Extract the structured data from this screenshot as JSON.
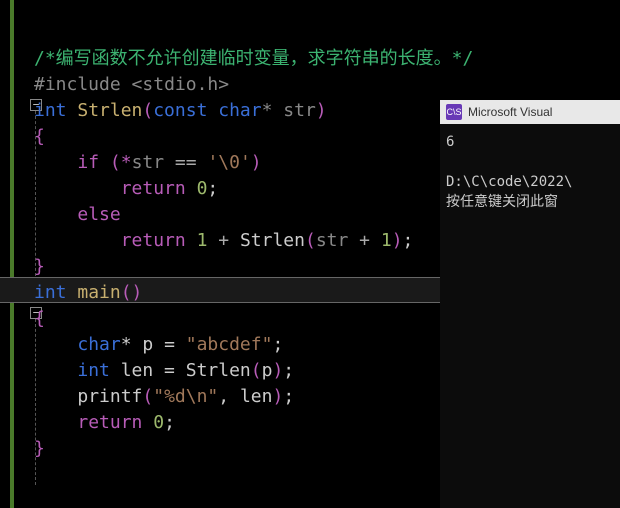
{
  "code": {
    "comment": "/*编写函数不允许创建临时变量，求字符串的长度。*/",
    "include_directive": "#include ",
    "include_open": "<",
    "include_header": "stdio.h",
    "include_close": ">",
    "fn1_kw1": "int",
    "fn1_name": " Strlen",
    "fn1_paren_o": "(",
    "fn1_kw2": "const ",
    "fn1_kw3": "char",
    "fn1_param": "* str",
    "fn1_paren_c": ")",
    "brace_o": "{",
    "if_kw": "if",
    "if_cond_o": " (*",
    "if_var": "str",
    "if_eq": " == ",
    "if_lit": "'\\0'",
    "if_cond_c": ")",
    "ret_kw": "return",
    "ret0_sp": " ",
    "num0": "0",
    "semi": ";",
    "else_kw": "else",
    "ret1_sp": " ",
    "num1": "1",
    "plus": " + ",
    "call1": "Strlen",
    "call1_arg_o": "(",
    "call1_var": "str",
    "call1_plus": " + ",
    "call1_num": "1",
    "call1_arg_c": ")",
    "brace_c": "}",
    "main_kw": "int",
    "main_name": " main",
    "main_parens": "()",
    "decl1_kw": "char",
    "decl1_rest": "* p = ",
    "decl1_str": "\"abcdef\"",
    "decl2_kw": "int",
    "decl2_rest": " len = ",
    "decl2_call": "Strlen",
    "decl2_arg_o": "(",
    "decl2_var": "p",
    "decl2_arg_c": ")",
    "printf_name": "printf",
    "printf_o": "(",
    "printf_fmt": "\"%d\\n\"",
    "printf_comma": ", ",
    "printf_var": "len",
    "printf_c": ")"
  },
  "console": {
    "title": "Microsoft Visual",
    "icon": "C\\S",
    "output": "6",
    "path": "D:\\C\\code\\2022\\",
    "prompt": "按任意键关闭此窗"
  },
  "folds": {
    "minus": "−"
  }
}
